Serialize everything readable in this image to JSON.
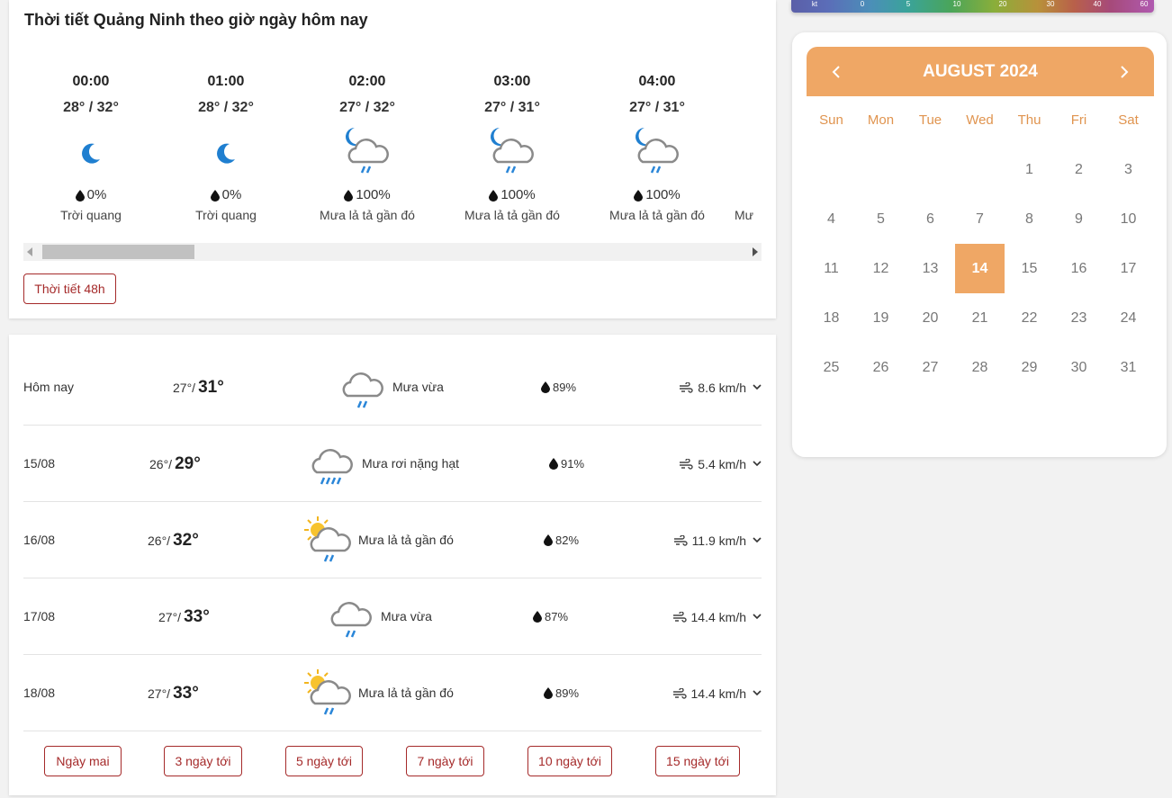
{
  "hourly": {
    "title": "Thời tiết Quảng Ninh theo giờ ngày hôm nay",
    "items": [
      {
        "time": "00:00",
        "temp": "28° / 32°",
        "icon": "moon-icon",
        "rain": "0%",
        "desc": "Trời quang"
      },
      {
        "time": "01:00",
        "temp": "28° / 32°",
        "icon": "moon-icon",
        "rain": "0%",
        "desc": "Trời quang"
      },
      {
        "time": "02:00",
        "temp": "27° / 32°",
        "icon": "moon-cloud-rain-icon",
        "rain": "100%",
        "desc": "Mưa lả tả gần đó"
      },
      {
        "time": "03:00",
        "temp": "27° / 31°",
        "icon": "moon-cloud-rain-icon",
        "rain": "100%",
        "desc": "Mưa lả tả gần đó"
      },
      {
        "time": "04:00",
        "temp": "27° / 31°",
        "icon": "moon-cloud-rain-icon",
        "rain": "100%",
        "desc": "Mưa lả tả gần đó"
      },
      {
        "time": "",
        "temp": "",
        "icon": "",
        "rain": "",
        "desc": "Mư"
      }
    ],
    "button_48h": "Thời tiết 48h"
  },
  "daily": {
    "rows": [
      {
        "date": "Hôm nay",
        "low": "27°",
        "high": "31°",
        "icon": "cloud-rain-icon",
        "desc": "Mưa vừa",
        "rain": "89%",
        "wind": "8.6 km/h"
      },
      {
        "date": "15/08",
        "low": "26°",
        "high": "29°",
        "icon": "cloud-heavy-rain-icon",
        "desc": "Mưa rơi nặng hạt",
        "rain": "91%",
        "wind": "5.4 km/h"
      },
      {
        "date": "16/08",
        "low": "26°",
        "high": "32°",
        "icon": "sun-cloud-rain-icon",
        "desc": "Mưa lả tả gần đó",
        "rain": "82%",
        "wind": "11.9 km/h"
      },
      {
        "date": "17/08",
        "low": "27°",
        "high": "33°",
        "icon": "cloud-rain-icon",
        "desc": "Mưa vừa",
        "rain": "87%",
        "wind": "14.4 km/h"
      },
      {
        "date": "18/08",
        "low": "27°",
        "high": "33°",
        "icon": "sun-cloud-rain-icon",
        "desc": "Mưa lả tả gần đó",
        "rain": "89%",
        "wind": "14.4 km/h"
      }
    ],
    "buttons": [
      "Ngày mai",
      "3 ngày tới",
      "5 ngày tới",
      "7 ngày tới",
      "10 ngày tới",
      "15 ngày tới"
    ]
  },
  "legend": {
    "ticks": [
      "kt",
      "0",
      "5",
      "10",
      "20",
      "30",
      "40",
      "60"
    ]
  },
  "calendar": {
    "title": "AUGUST 2024",
    "weekdays": [
      "Sun",
      "Mon",
      "Tue",
      "Wed",
      "Thu",
      "Fri",
      "Sat"
    ],
    "days": [
      "1",
      "2",
      "3",
      "4",
      "5",
      "6",
      "7",
      "8",
      "9",
      "10",
      "11",
      "12",
      "13",
      "14",
      "15",
      "16",
      "17",
      "18",
      "19",
      "20",
      "21",
      "22",
      "23",
      "24",
      "25",
      "26",
      "27",
      "28",
      "29",
      "30",
      "31"
    ],
    "today": "14",
    "accent": "#efa765"
  },
  "colors": {
    "accent_red": "#a52a2a",
    "moon_blue": "#1f7fd0",
    "rain_blue": "#2a86d8"
  }
}
